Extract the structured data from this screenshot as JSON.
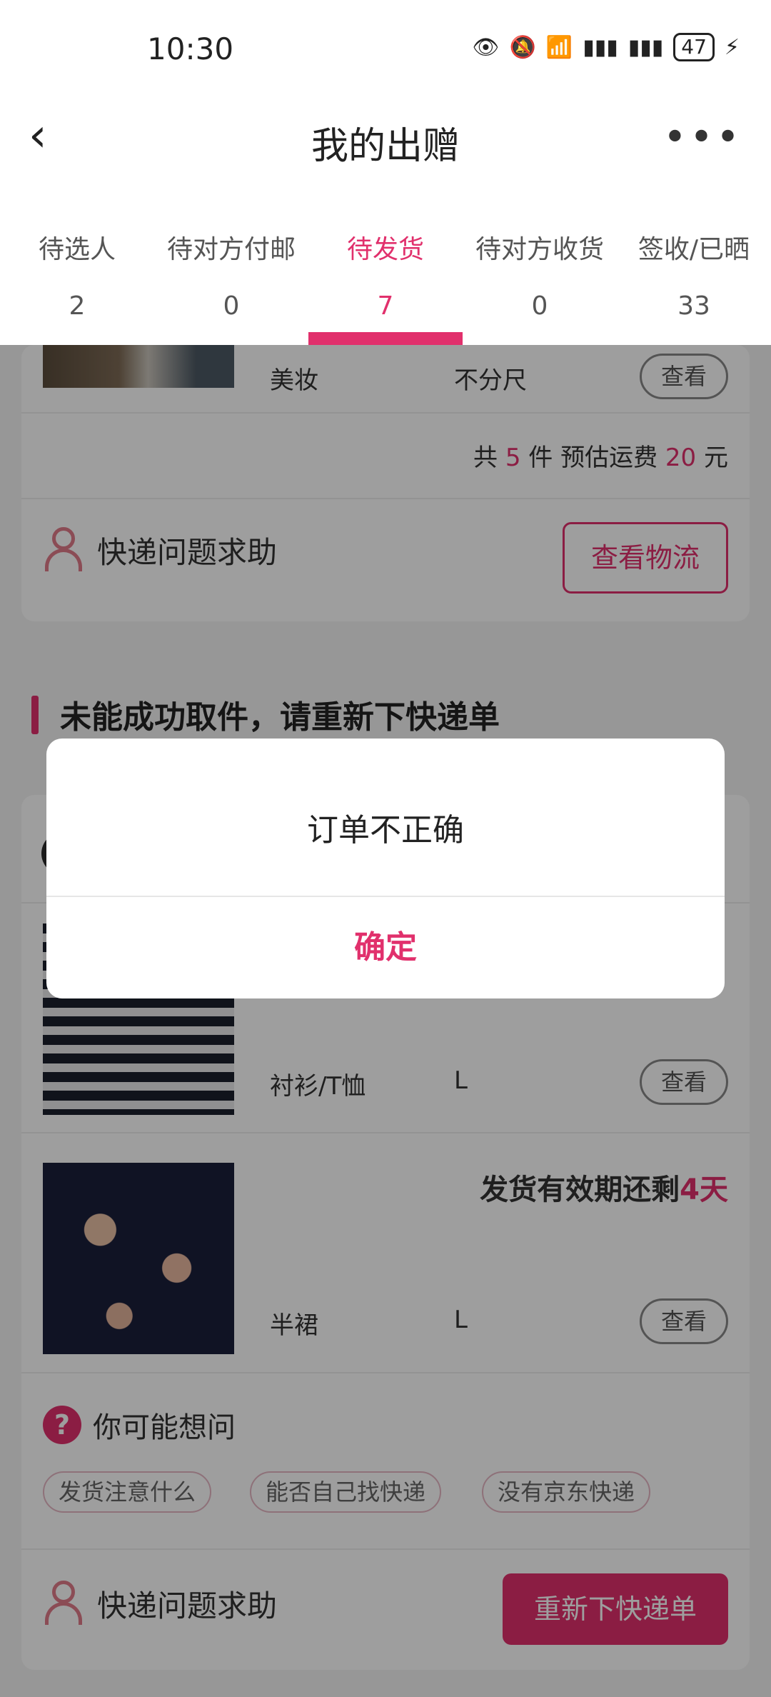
{
  "status": {
    "time": "10:30",
    "battery": "47",
    "icons": [
      "eye-icon",
      "bell-off-icon",
      "wifi-icon",
      "signal-4g-icon",
      "signal-4g-icon",
      "charging-icon"
    ]
  },
  "nav": {
    "title": "我的出赠"
  },
  "tabs": [
    {
      "label": "待选人",
      "count": "2"
    },
    {
      "label": "待对方付邮",
      "count": "0"
    },
    {
      "label": "待发货",
      "count": "7"
    },
    {
      "label": "待对方收货",
      "count": "0"
    },
    {
      "label": "签收/已晒",
      "count": "33"
    }
  ],
  "card1": {
    "item": {
      "category": "美妆",
      "size": "不分尺",
      "view": "查看"
    },
    "summary": {
      "prefix": "共",
      "count": "5",
      "mid": "件 预估运费",
      "fee": "20",
      "unit": "元"
    },
    "help": "快递问题求助",
    "logistics_button": "查看物流"
  },
  "section": {
    "heading": "未能成功取件，请重新下快递单"
  },
  "card2": {
    "items": [
      {
        "category": "衬衫/T恤",
        "size": "L",
        "view": "查看"
      },
      {
        "deadline_prefix": "发货有效期还剩",
        "deadline_value": "4天",
        "category": "半裙",
        "size": "L",
        "view": "查看"
      }
    ],
    "faq": {
      "title": "你可能想问",
      "chips": [
        "发货注意什么",
        "能否自己找快递",
        "没有京东快递"
      ]
    },
    "help": "快递问题求助",
    "reorder_button": "重新下快递单"
  },
  "dialog": {
    "message": "订单不正确",
    "confirm": "确定"
  },
  "colors": {
    "accent": "#e1306c"
  }
}
